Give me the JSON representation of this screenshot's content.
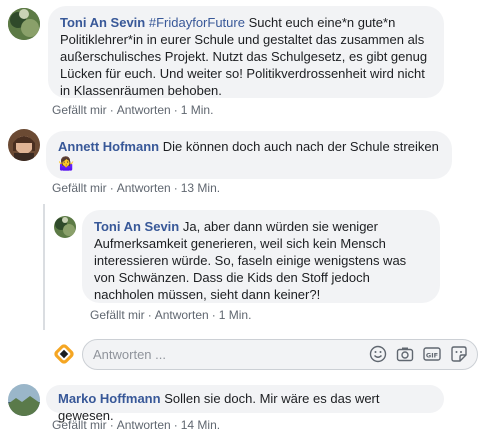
{
  "comments": [
    {
      "author": "Toni An Sevin",
      "hashtag": "#FridayforFuture",
      "text": "Sucht euch eine*n gute*n Politiklehrer*in in eurer Schule und gestaltet das zusammen als außerschulisches Projekt. Nutzt das Schulgesetz, es gibt genug Lücken für euch. Und weiter so! Politikverdrossenheit wird nicht in Klassenräumen behoben.",
      "like": "Gefällt mir",
      "reply": "Antworten",
      "time": "1 Min."
    },
    {
      "author": "Annett Hofmann",
      "text": "Die können doch auch nach der Schule streiken",
      "emoji": "🤷‍♀️",
      "like": "Gefällt mir",
      "reply": "Antworten",
      "time": "13 Min."
    },
    {
      "author": "Toni An Sevin",
      "text": "Ja, aber dann würden sie weniger Aufmerksamkeit generieren, weil sich kein Mensch interessieren würde. So, faseln einige wenigstens was von Schwänzen. Dass die Kids den Stoff jedoch nachholen müssen, sieht dann keiner?!",
      "like": "Gefällt mir",
      "reply": "Antworten",
      "time": "1 Min."
    },
    {
      "author": "Marko Hoffmann",
      "text": "Sollen sie doch. Mir wäre es das wert gewesen.",
      "like": "Gefällt mir",
      "reply": "Antworten",
      "time": "14 Min."
    }
  ],
  "reply_box": {
    "placeholder": "Antworten ...",
    "tools": [
      "emoji-icon",
      "camera-icon",
      "gif-icon",
      "sticker-icon"
    ]
  },
  "colors": {
    "author": "#385898",
    "bubble": "#f2f3f5",
    "meta": "#606770"
  }
}
